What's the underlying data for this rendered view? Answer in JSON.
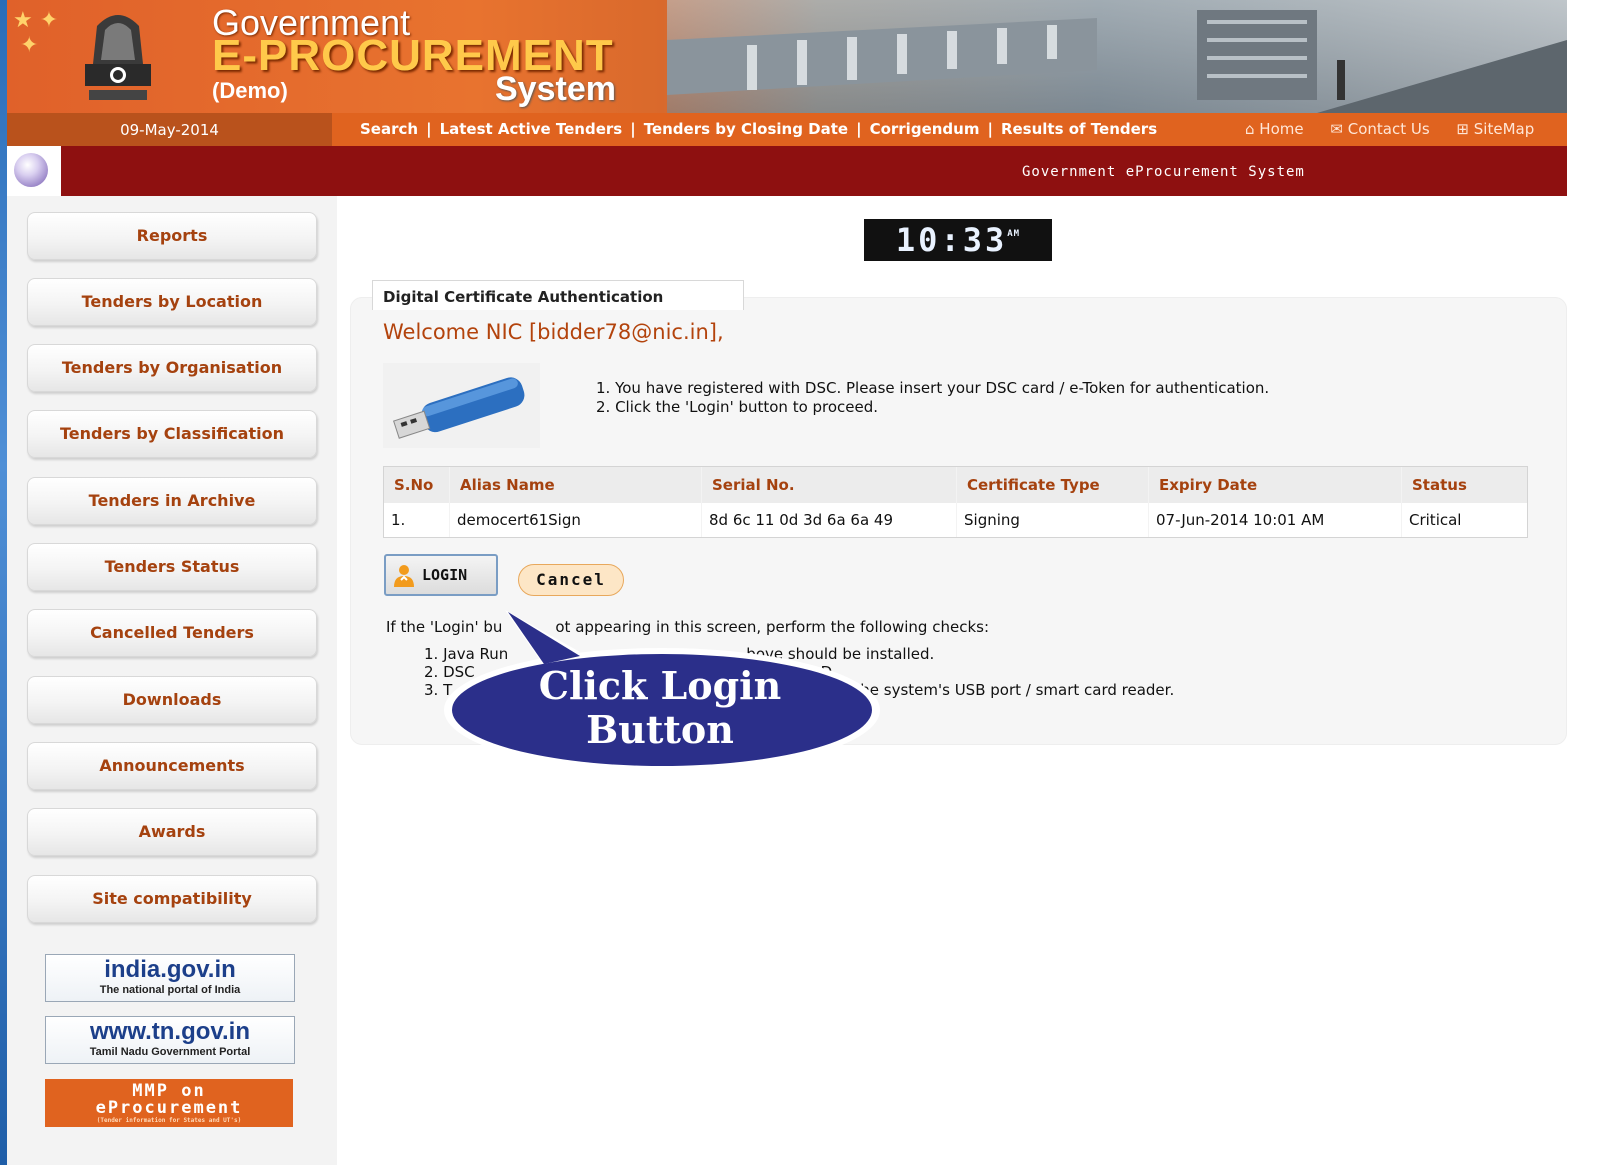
{
  "header": {
    "title_line1": "Government",
    "title_line2": "E-PROCUREMENT",
    "title_line3": "System",
    "demo_label": "(Demo)"
  },
  "nav": {
    "date": "09-May-2014",
    "links": [
      "Search",
      "Latest Active Tenders",
      "Tenders by Closing Date",
      "Corrigendum",
      "Results of Tenders"
    ],
    "separator": "|",
    "right_links": [
      {
        "label": "Home",
        "icon": "home-icon"
      },
      {
        "label": "Contact Us",
        "icon": "mail-icon"
      },
      {
        "label": "SiteMap",
        "icon": "sitemap-icon"
      }
    ]
  },
  "tagline": "Government eProcurement System",
  "sidebar": {
    "items": [
      "Reports",
      "Tenders by Location",
      "Tenders by Organisation",
      "Tenders by Classification",
      "Tenders in Archive",
      "Tenders Status",
      "Cancelled Tenders",
      "Downloads",
      "Announcements",
      "Awards",
      "Site compatibility"
    ],
    "portals": [
      {
        "main": "india.gov.in",
        "sub": "The national portal of India"
      },
      {
        "main": "www.tn.gov.in",
        "sub": "Tamil Nadu Government Portal"
      }
    ],
    "mmp": {
      "line1": "MMP on",
      "line2": "eProcurement",
      "line3": "(Tender information for States and UT's)"
    }
  },
  "clock": {
    "time": "10:33",
    "ampm": "AM"
  },
  "panel": {
    "tab_title": "Digital Certificate Authentication",
    "welcome": "Welcome NIC [bidder78@nic.in],",
    "instructions": [
      "1.  You have registered with DSC. Please insert your DSC card / e-Token for authentication.",
      "2.  Click the 'Login' button to proceed."
    ]
  },
  "table": {
    "headers": [
      "S.No",
      "Alias Name",
      "Serial No.",
      "Certificate Type",
      "Expiry Date",
      "Status"
    ],
    "rows": [
      [
        "1.",
        "democert61Sign",
        "8d 6c 11 0d 3d 6a 6a 49",
        "Signing",
        "07-Jun-2014 10:01 AM",
        "Critical"
      ]
    ]
  },
  "buttons": {
    "login": "LOGIN",
    "cancel": "Cancel"
  },
  "checks": {
    "intro_left": "If the 'Login' bu",
    "intro_right": "ot appearing in this screen, perform the following checks:",
    "items": [
      {
        "left": "1.  Java Run",
        "right": "bove should be installed."
      },
      {
        "left": "2.  DSC",
        "right": "D."
      },
      {
        "left": "3.  T",
        "right": "he system's USB port / smart card reader."
      }
    ]
  },
  "callout": {
    "line1": "Click  Login",
    "line2": "Button"
  },
  "colors": {
    "accent_orange": "#e0631f",
    "dark_red": "#8e1010",
    "sidebar_text": "#a5420f",
    "callout_blue": "#2b2f8a"
  }
}
